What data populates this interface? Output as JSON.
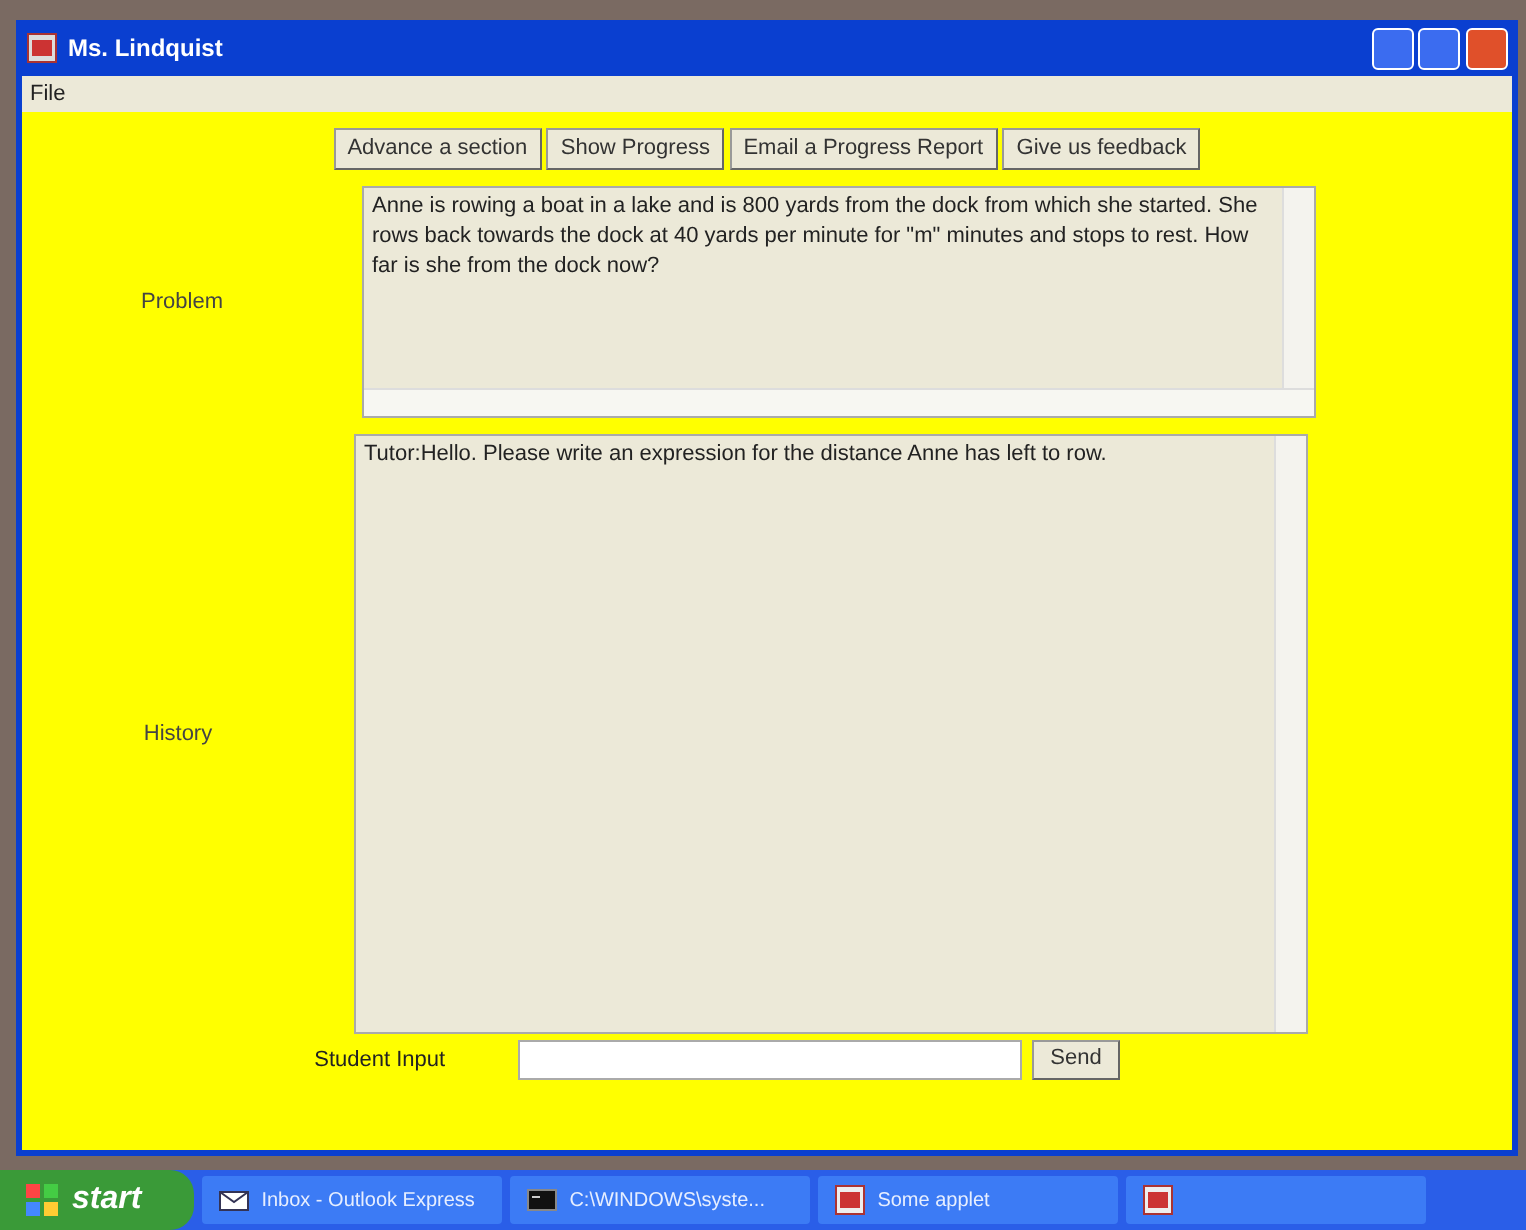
{
  "window": {
    "title": "Ms. Lindquist"
  },
  "menu": [
    "File"
  ],
  "toolbar": [
    "Advance a section",
    "Show Progress",
    "Email a Progress Report",
    "Give us feedback"
  ],
  "problem": {
    "label": "Problem",
    "text": "Anne is rowing a boat in a lake and is 800 yards from the dock from which she started.  She rows back towards the dock at 40 yards per minute for \"m\" minutes and stops to rest.  How far is she from the dock now?"
  },
  "history": {
    "label": "History",
    "text": "Tutor:Hello.  Please write an expression for the distance Anne has left to row."
  },
  "input": {
    "label": "Student Input",
    "button": "Send"
  },
  "taskbar": {
    "start": "start",
    "items": [
      {
        "kind": "mail",
        "label": "Inbox - Outlook Express"
      },
      {
        "kind": "console",
        "label": "C:\\WINDOWS\\syste..."
      },
      {
        "kind": "applet",
        "label": "Some applet"
      },
      {
        "kind": "applet"
      }
    ]
  }
}
